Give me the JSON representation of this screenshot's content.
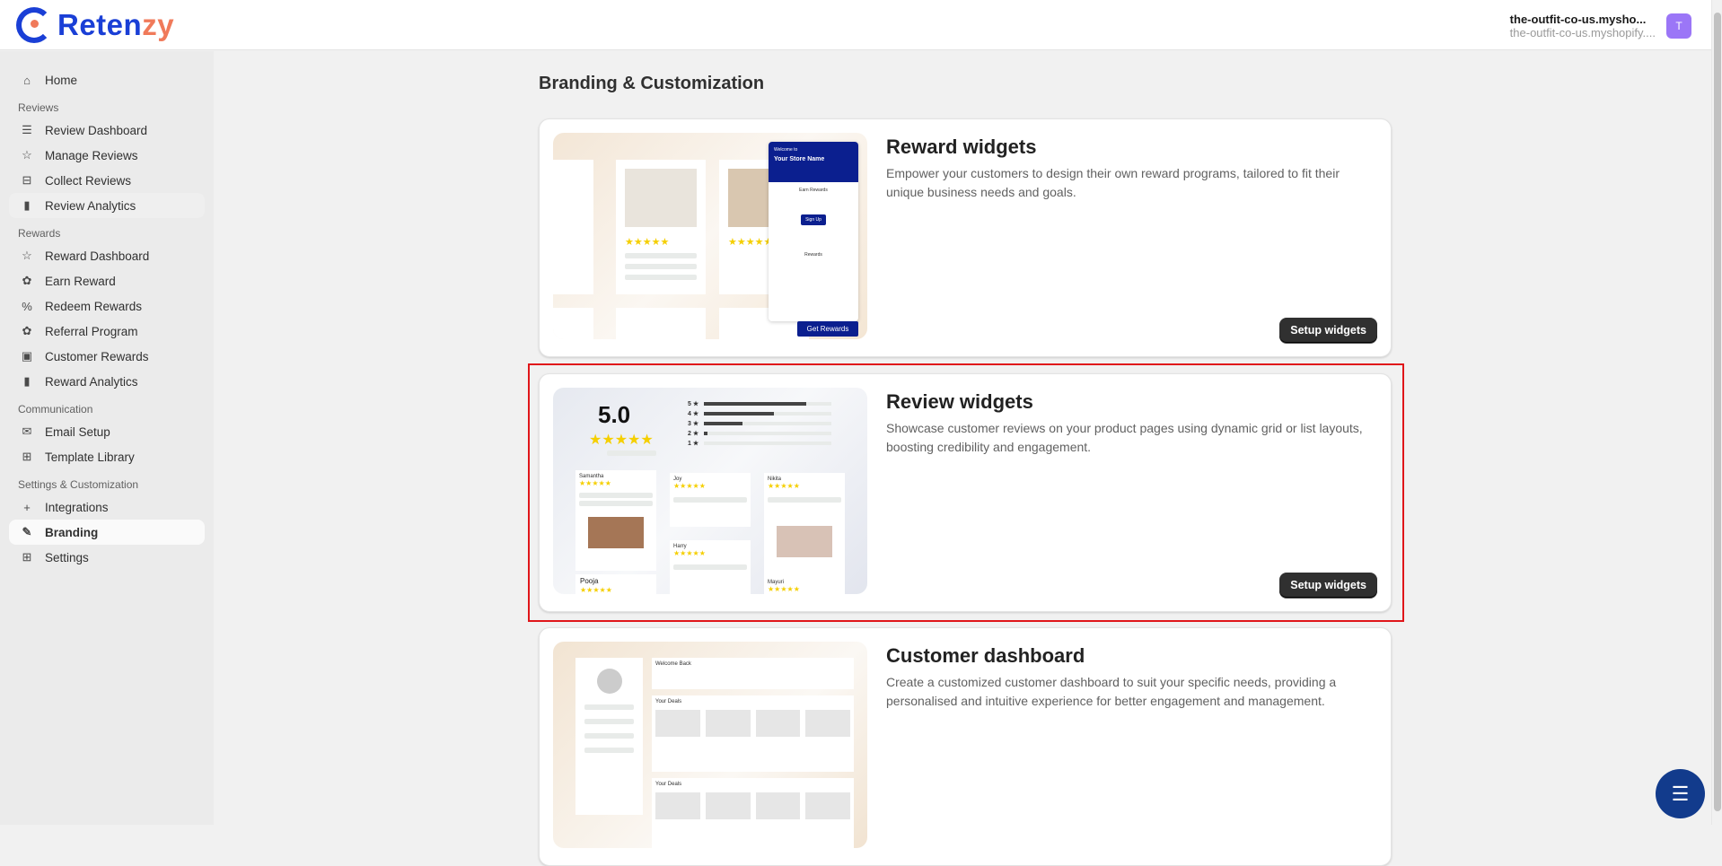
{
  "app": {
    "logo_main": "Reten",
    "logo_accent": "zy"
  },
  "store": {
    "name": "the-outfit-co-us.mysho...",
    "domain": "the-outfit-co-us.myshopify....",
    "avatar": "T"
  },
  "sidebar": {
    "home": "Home",
    "sections": [
      {
        "label": "Reviews",
        "items": [
          "Review Dashboard",
          "Manage Reviews",
          "Collect Reviews",
          "Review Analytics"
        ]
      },
      {
        "label": "Rewards",
        "items": [
          "Reward Dashboard",
          "Earn Reward",
          "Redeem Rewards",
          "Referral Program",
          "Customer Rewards",
          "Reward Analytics"
        ]
      },
      {
        "label": "Communication",
        "items": [
          "Email Setup",
          "Template Library"
        ]
      },
      {
        "label": "Settings & Customization",
        "items": [
          "Integrations",
          "Branding",
          "Settings"
        ]
      }
    ]
  },
  "page": {
    "title": "Branding & Customization"
  },
  "cards": [
    {
      "title": "Reward widgets",
      "description": "Empower your customers to design their own reward programs, tailored to fit their unique business needs and goals.",
      "button": "Setup widgets",
      "preview": {
        "welcome": "Welcome to",
        "store": "Your Store Name",
        "earn": "Earn Rewards",
        "signup": "Sign Up",
        "rewards": "Rewards",
        "cta": "Get Rewards"
      }
    },
    {
      "title": "Review widgets",
      "description": "Showcase customer reviews on your product pages using dynamic grid or list layouts, boosting credibility and engagement.",
      "button": "Setup widgets",
      "preview": {
        "rating": "5.0",
        "distribution": [
          0.8,
          0.55,
          0.3,
          0.03,
          0
        ],
        "reviewers": [
          "Samantha",
          "Joy",
          "Nikita",
          "Harry",
          "Pooja",
          "Mayuri"
        ]
      }
    },
    {
      "title": "Customer dashboard",
      "description": "Create a customized customer dashboard to suit your specific needs, providing a personalised and intuitive experience for better engagement and management.",
      "preview": {
        "welcome": "Welcome Back",
        "deals1": "Your Deals",
        "deals2": "Your Deals"
      }
    }
  ],
  "colors": {
    "accent": "#1a3fd6",
    "logo_accent": "#f07a5a",
    "avatar": "#9b76f7",
    "button": "#303030",
    "selection": "#e0161a",
    "chat": "#123b8c"
  }
}
